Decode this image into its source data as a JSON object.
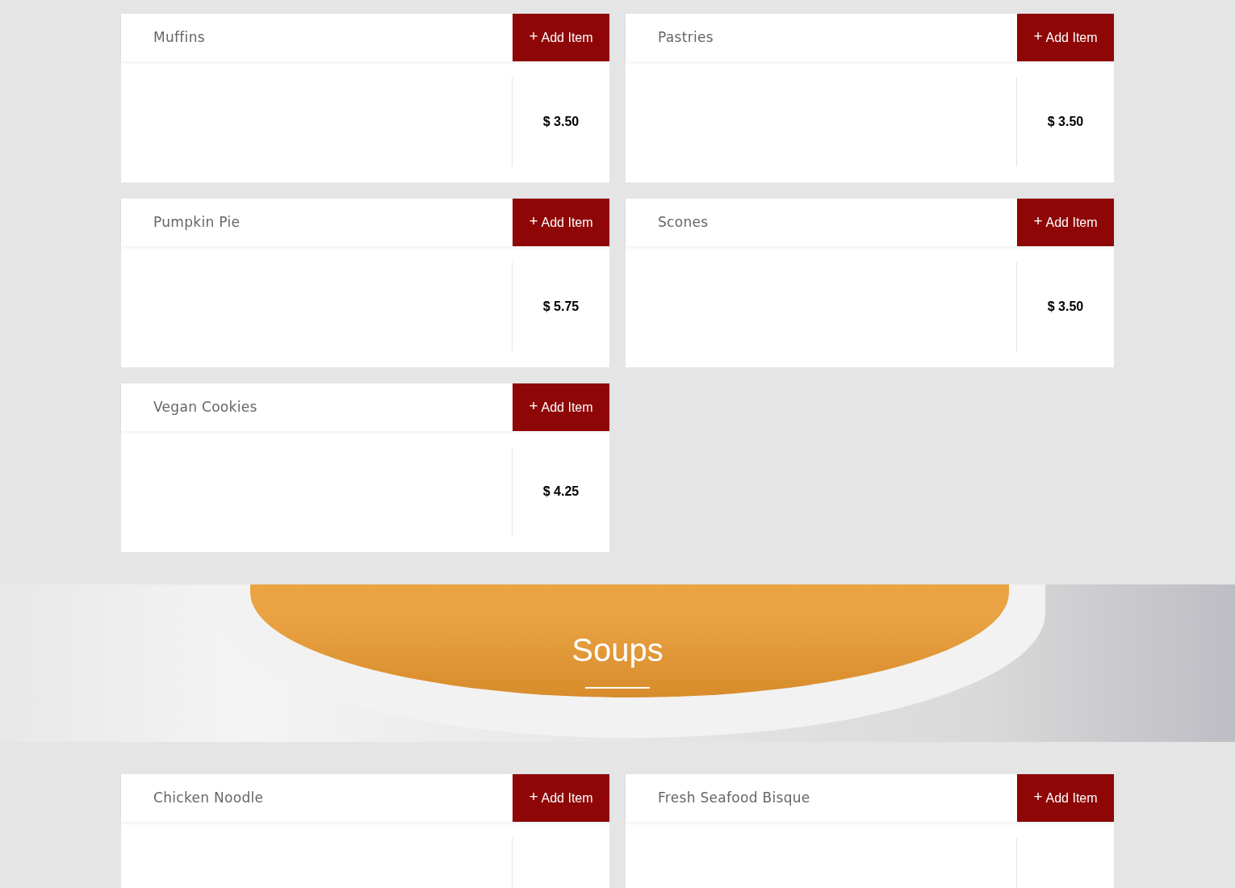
{
  "sections": [
    {
      "kind": "items",
      "items": [
        {
          "name": "Muffins",
          "price": "$ 3.50",
          "button": {
            "icon": "+",
            "label": "Add Item"
          }
        },
        {
          "name": "Pastries",
          "price": "$ 3.50",
          "button": {
            "icon": "+",
            "label": "Add Item"
          }
        },
        {
          "name": "Pumpkin Pie",
          "price": "$ 5.75",
          "button": {
            "icon": "+",
            "label": "Add Item"
          }
        },
        {
          "name": "Scones",
          "price": "$ 3.50",
          "button": {
            "icon": "+",
            "label": "Add Item"
          }
        },
        {
          "name": "Vegan Cookies",
          "price": "$ 4.25",
          "button": {
            "icon": "+",
            "label": "Add Item"
          }
        }
      ]
    },
    {
      "kind": "banner",
      "title": "Soups"
    },
    {
      "kind": "items",
      "items": [
        {
          "name": "Chicken Noodle",
          "button": {
            "icon": "+",
            "label": "Add Item"
          }
        },
        {
          "name": "Fresh Seafood Bisque",
          "button": {
            "icon": "+",
            "label": "Add Item"
          }
        }
      ]
    }
  ]
}
